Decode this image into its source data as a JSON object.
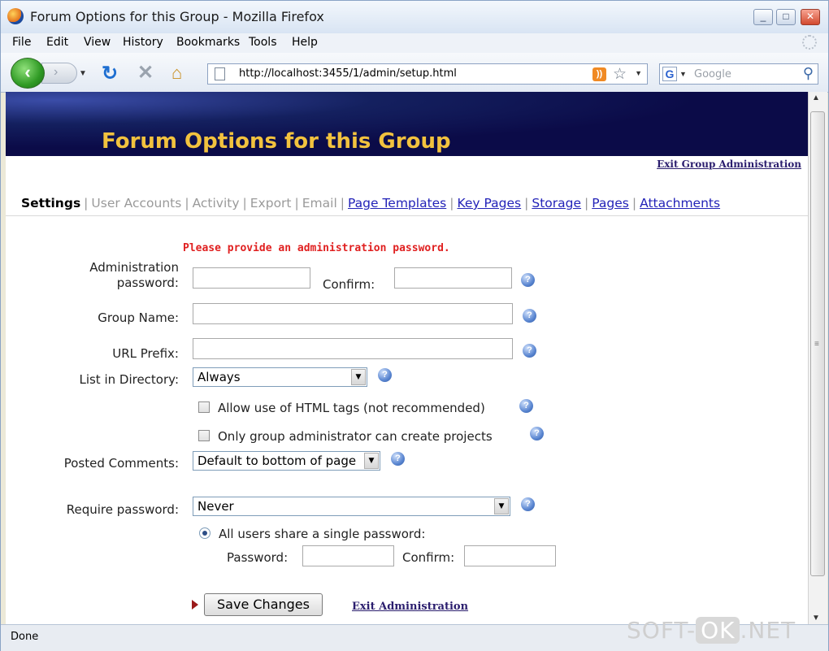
{
  "window": {
    "title": "Forum Options for this Group - Mozilla Firefox",
    "controls": [
      "_",
      "□",
      "✕"
    ]
  },
  "menu": [
    "File",
    "Edit",
    "View",
    "History",
    "Bookmarks",
    "Tools",
    "Help"
  ],
  "toolbar": {
    "back": "‹",
    "forward": "›",
    "url": "http://localhost:3455/1/admin/setup.html",
    "search_placeholder": "Google",
    "search_engine": "G"
  },
  "page": {
    "banner_title": "Forum Options for this Group",
    "exit_group_admin": "Exit Group Administration",
    "tabs": {
      "active": "Settings",
      "disabled": [
        "User Accounts",
        "Activity",
        "Export",
        "Email"
      ],
      "links": [
        "Page Templates",
        "Key Pages",
        "Storage",
        "Pages",
        "Attachments"
      ]
    },
    "error": "Please provide an administration password.",
    "form": {
      "admin_password_label_1": "Administration",
      "admin_password_label_2": "password:",
      "confirm_label": "Confirm:",
      "group_name_label": "Group Name:",
      "url_prefix_label": "URL Prefix:",
      "list_directory_label": "List in Directory:",
      "list_directory_value": "Always",
      "allow_html_label": "Allow use of HTML tags (not recommended)",
      "only_admin_label": "Only group administrator can create projects",
      "posted_comments_label": "Posted Comments:",
      "posted_comments_value": "Default to bottom of page",
      "require_password_label": "Require password:",
      "require_password_value": "Never",
      "share_password_label": "All users share a single password:",
      "password_label": "Password:",
      "confirm2_label": "Confirm:"
    },
    "save_label": "Save Changes",
    "exit_admin": "Exit Administration"
  },
  "status": "Done",
  "watermark": {
    "left": "SOFT-",
    "ok": "OK",
    "right": ".NET"
  },
  "colors": {
    "banner_title": "#f2c23e",
    "error": "#e02020",
    "link": "#2323b8"
  }
}
